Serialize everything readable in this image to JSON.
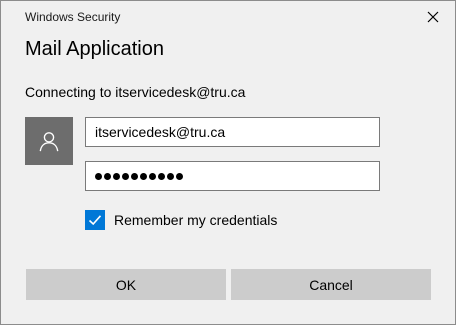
{
  "window": {
    "title": "Windows Security"
  },
  "dialog": {
    "heading": "Mail Application",
    "connecting_text": "Connecting to itservicedesk@tru.ca"
  },
  "form": {
    "username_value": "itservicedesk@tru.ca",
    "password_mask_count": 10,
    "remember_label": "Remember my credentials",
    "remember_checked": true
  },
  "buttons": {
    "ok_label": "OK",
    "cancel_label": "Cancel"
  },
  "icons": {
    "close": "close-icon",
    "avatar": "user-icon",
    "check": "checkmark-icon"
  },
  "colors": {
    "accent": "#0078d7",
    "avatar_bg": "#6d6d6d",
    "button_bg": "#cccccc",
    "window_bg": "#f0f0f0"
  }
}
